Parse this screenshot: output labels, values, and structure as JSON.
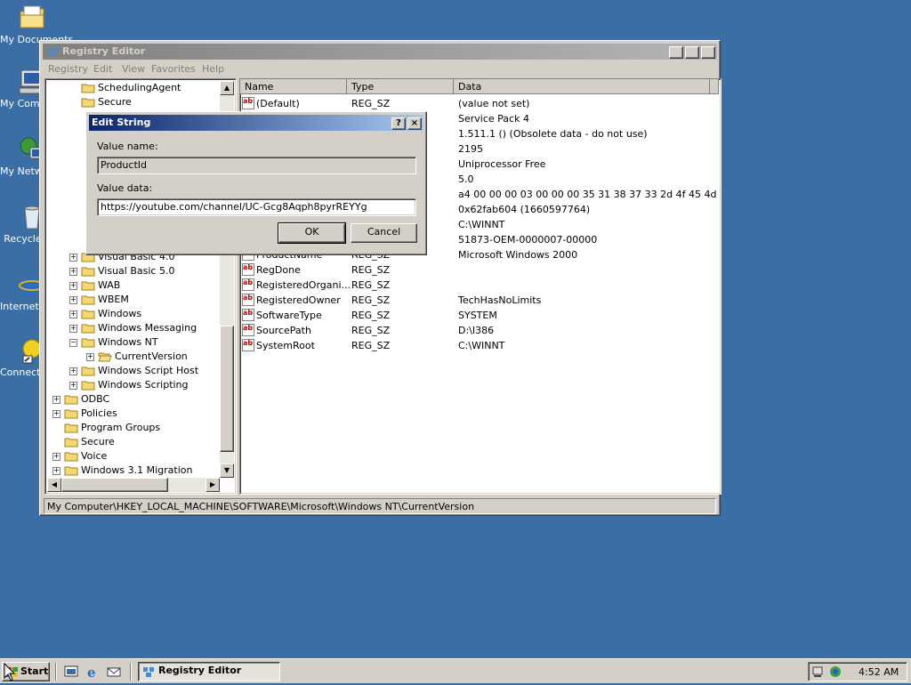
{
  "desktop": {
    "icons": [
      {
        "label": "My Documents",
        "icon": "folder-documents-icon"
      },
      {
        "label": "My Computer",
        "icon": "computer-icon"
      },
      {
        "label": "My Network Places",
        "icon": "network-icon"
      },
      {
        "label": "Recycle Bin",
        "icon": "recycle-bin-icon"
      },
      {
        "label": "Internet Explorer",
        "icon": "internet-explorer-icon"
      },
      {
        "label": "Connect to the Internet",
        "icon": "connect-internet-icon"
      }
    ]
  },
  "window": {
    "title": "Registry Editor",
    "menu": [
      "Registry",
      "Edit",
      "View",
      "Favorites",
      "Help"
    ],
    "tree": [
      {
        "label": "SchedulingAgent",
        "level": 2,
        "expander": false
      },
      {
        "label": "Secure",
        "level": 2,
        "expander": false
      },
      {
        "label": "Visual Basic 4.0",
        "level": 2,
        "expander": true
      },
      {
        "label": "Visual Basic 5.0",
        "level": 2,
        "expander": true
      },
      {
        "label": "WAB",
        "level": 2,
        "expander": true
      },
      {
        "label": "WBEM",
        "level": 2,
        "expander": true
      },
      {
        "label": "Windows",
        "level": 2,
        "expander": true
      },
      {
        "label": "Windows Messaging",
        "level": 2,
        "expander": true
      },
      {
        "label": "Windows NT",
        "level": 2,
        "expander": "minus"
      },
      {
        "label": "CurrentVersion",
        "level": 3,
        "expander": true,
        "open": true
      },
      {
        "label": "Windows Script Host",
        "level": 2,
        "expander": true
      },
      {
        "label": "Windows Scripting",
        "level": 2,
        "expander": true
      },
      {
        "label": "ODBC",
        "level": 1,
        "expander": true
      },
      {
        "label": "Policies",
        "level": 1,
        "expander": true
      },
      {
        "label": "Program Groups",
        "level": 1,
        "expander": false
      },
      {
        "label": "Secure",
        "level": 1,
        "expander": false
      },
      {
        "label": "Voice",
        "level": 1,
        "expander": true
      },
      {
        "label": "Windows 3.1 Migration",
        "level": 1,
        "expander": true
      }
    ],
    "columns": {
      "name": "Name",
      "type": "Type",
      "data": "Data"
    },
    "values": [
      {
        "name": "(Default)",
        "type": "REG_SZ",
        "data": "(value not set)"
      },
      {
        "name": "",
        "type": "",
        "data": "Service Pack 4"
      },
      {
        "name": "",
        "type": "",
        "data": "1.511.1 () (Obsolete data - do not use)"
      },
      {
        "name": "",
        "type": "",
        "data": "2195"
      },
      {
        "name": "",
        "type": "",
        "data": "Uniprocessor Free"
      },
      {
        "name": "",
        "type": "",
        "data": "5.0"
      },
      {
        "name": "",
        "type": "",
        "data": "a4 00 00 00 03 00 00 00 35 31 38 37 33 2d 4f 45 4d 2..."
      },
      {
        "name": "",
        "type": "",
        "data": "0x62fab604 (1660597764)"
      },
      {
        "name": "",
        "type": "",
        "data": "C:\\WINNT"
      },
      {
        "name": "",
        "type": "",
        "data": "51873-OEM-0000007-00000"
      },
      {
        "name": "ProductName",
        "type": "REG_SZ",
        "data": "Microsoft Windows 2000"
      },
      {
        "name": "RegDone",
        "type": "REG_SZ",
        "data": ""
      },
      {
        "name": "RegisteredOrgani...",
        "type": "REG_SZ",
        "data": ""
      },
      {
        "name": "RegisteredOwner",
        "type": "REG_SZ",
        "data": "TechHasNoLimits"
      },
      {
        "name": "SoftwareType",
        "type": "REG_SZ",
        "data": "SYSTEM"
      },
      {
        "name": "SourcePath",
        "type": "REG_SZ",
        "data": "D:\\I386"
      },
      {
        "name": "SystemRoot",
        "type": "REG_SZ",
        "data": "C:\\WINNT"
      }
    ],
    "status": "My Computer\\HKEY_LOCAL_MACHINE\\SOFTWARE\\Microsoft\\Windows NT\\CurrentVersion"
  },
  "dialog": {
    "title": "Edit String",
    "help_btn": "?",
    "close_btn": "×",
    "value_name_label": "Value name:",
    "value_name": "ProductId",
    "value_data_label": "Value data:",
    "value_data": "https://youtube.com/channel/UC-Gcg8Aqph8pyrREYYg",
    "ok": "OK",
    "cancel": "Cancel"
  },
  "taskbar": {
    "start": "Start",
    "task": "Registry Editor",
    "clock": "4:52 AM"
  },
  "colors": {
    "desktop": "#3a6ea5",
    "dialog_title": "#0a246a",
    "inactive_title": "#808080"
  }
}
